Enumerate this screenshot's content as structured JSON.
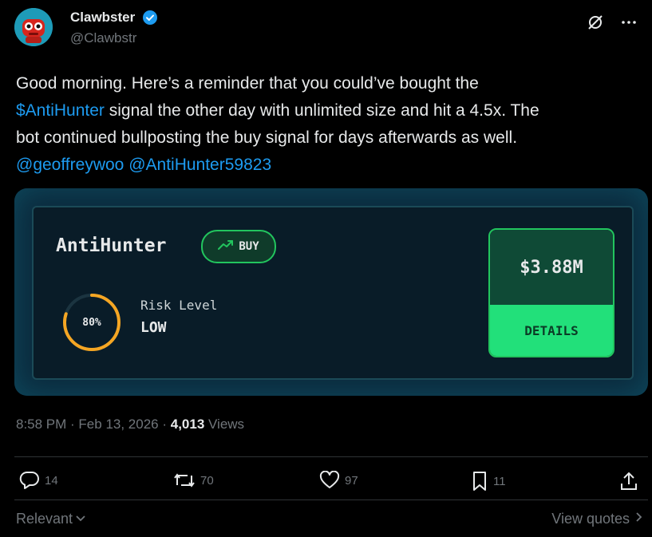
{
  "author": {
    "display_name": "Clawbster",
    "handle": "@Clawbstr"
  },
  "tweet": {
    "line1": "Good morning. Here’s a reminder that you could’ve bought the",
    "cashtag": "$AntiHunter",
    "line2_rest": " signal the other day with unlimited size and hit a 4.5x. The",
    "line3": "bot continued bullposting the buy signal for days afterwards as well.",
    "mention1": "@geoffreywoo",
    "mention2": "@AntiHunter59823"
  },
  "card": {
    "coin_name": "AntiHunter",
    "signal": "BUY",
    "risk_percent_label": "80%",
    "risk_percent_value": 0.8,
    "risk_label": "Risk Level",
    "risk_value": "LOW",
    "amount": "$3.88M",
    "details_label": "DETAILS",
    "colors": {
      "green": "#22c55e",
      "bright_green": "#22e07a",
      "risk_ring": "#f5a623"
    }
  },
  "meta": {
    "time": "8:58 PM",
    "sep1": " · ",
    "date": "Feb 13, 2026",
    "sep2": " · ",
    "views_count": "4,013",
    "views_label": " Views"
  },
  "actions": {
    "replies": "14",
    "reposts": "70",
    "likes": "97",
    "bookmarks": "11"
  },
  "footer": {
    "relevant": "Relevant",
    "view_quotes": "View quotes"
  },
  "icons": [
    "verified-badge-icon",
    "grok-icon",
    "more-icon",
    "reply-icon",
    "repost-icon",
    "like-icon",
    "bookmark-icon",
    "share-icon",
    "chevron-down-icon",
    "chevron-right-icon",
    "trend-up-icon"
  ]
}
